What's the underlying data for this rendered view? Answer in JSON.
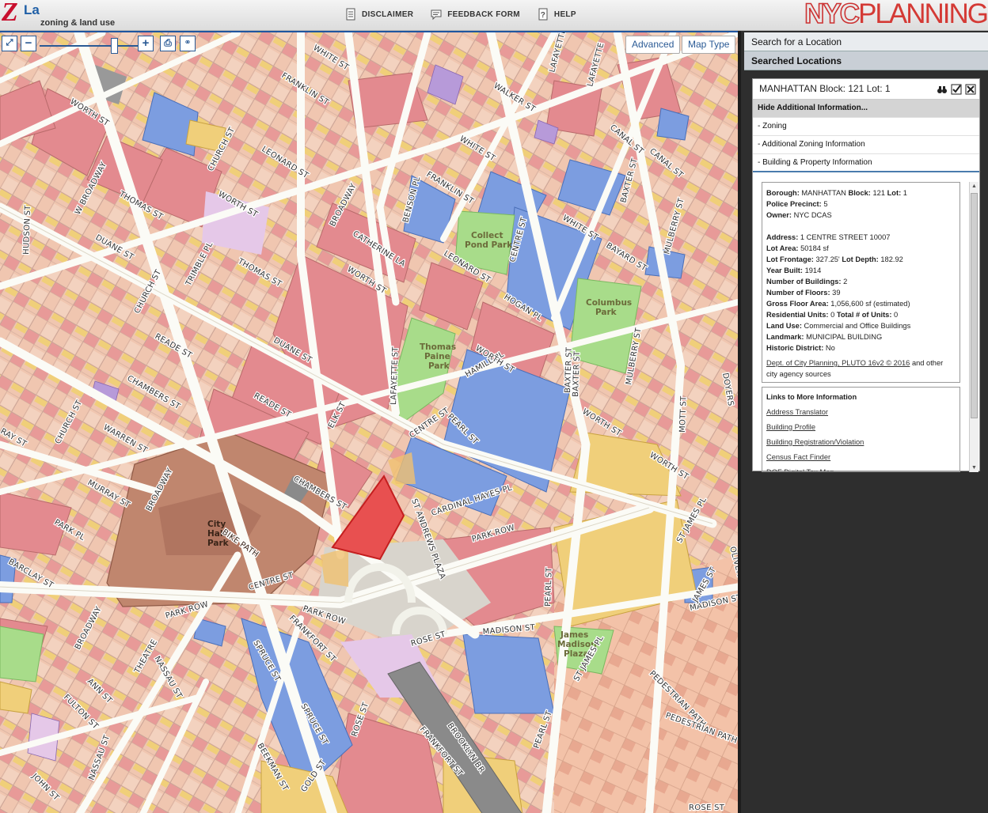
{
  "header": {
    "logo_mark": "Z",
    "logo_la": "La",
    "logo_subtitle": "zoning & land use",
    "nav": [
      {
        "label": "DISCLAIMER",
        "icon": "document-icon"
      },
      {
        "label": "FEEDBACK FORM",
        "icon": "speech-bubble-icon"
      },
      {
        "label": "HELP",
        "icon": "help-icon"
      }
    ],
    "brand_nyc": "NYC",
    "brand_planning": "PLANNING"
  },
  "map": {
    "controls": {
      "zoom_out": "−",
      "zoom_in": "+",
      "advanced_label": "Advanced",
      "map_type_label": "Map Type"
    },
    "parks": [
      "Collect Pond Park",
      "Columbus Park",
      "Thomas Paine Park",
      "City Hall Park",
      "James Madison Plaza"
    ],
    "streets": [
      "WHITE ST",
      "WORTH ST",
      "FRANKLIN ST",
      "LEONARD ST",
      "CHURCH ST",
      "W BROADWAY",
      "THOMAS ST",
      "DUANE ST",
      "HUDSON ST",
      "TRIMBLE PL",
      "READE ST",
      "CHAMBERS ST",
      "WARREN ST",
      "MURRAY ST",
      "PARK PL",
      "BARCLAY ST",
      "BROADWAY",
      "CATHERINE LA",
      "LAFAYETTE ST",
      "CENTRE ST",
      "BAXTER ST",
      "MULBERRY ST",
      "HOGAN PL",
      "PEARL ST",
      "HAMILL PL",
      "CANAL ST",
      "WALKER ST",
      "LAFAYETTE",
      "ELK ST",
      "CARDINAL HAYES PL",
      "ST ANDREWS PLAZA",
      "PARK ROW",
      "MADISON ST",
      "ROSE ST",
      "SPRUCE ST",
      "FRANKFORT ST",
      "BEEKMAN ST",
      "NASSAU ST",
      "ANN ST",
      "FULTON ST",
      "JOHN ST",
      "GOLD ST",
      "BROOKLYN BR",
      "PEDESTRIAN PATH",
      "JAMES ST",
      "ST JAMES PL",
      "OLIVER",
      "MOTT ST",
      "DOYERS",
      "BAYARD ST",
      "BENSON PL",
      "THEATRE",
      "BIKE PATH"
    ]
  },
  "panel": {
    "search_label": "Search for a Location",
    "searched_label": "Searched Locations",
    "card": {
      "title": "MANHATTAN Block: 121 Lot: 1",
      "hide_label": "Hide Additional Information...",
      "sections": [
        "- Zoning",
        "- Additional Zoning Information",
        "- Building & Property Information"
      ],
      "info": {
        "borough_label": "Borough:",
        "borough": "MANHATTAN",
        "block_label": "Block:",
        "block": "121",
        "lot_label": "Lot:",
        "lot": "1",
        "precinct_label": "Police Precinct:",
        "precinct": "5",
        "owner_label": "Owner:",
        "owner": "NYC DCAS",
        "address_label": "Address:",
        "address": "1 CENTRE STREET  10007",
        "lot_area_label": "Lot Area:",
        "lot_area": "50184 sf",
        "frontage_label": "Lot Frontage:",
        "frontage": "327.25'",
        "depth_label": "Lot Depth:",
        "depth": "182.92",
        "year_label": "Year Built:",
        "year": "1914",
        "buildings_label": "Number of Buildings:",
        "buildings": "2",
        "floors_label": "Number of Floors:",
        "floors": "39",
        "gfa_label": "Gross Floor Area:",
        "gfa": "1,056,600 sf (estimated)",
        "resunits_label": "Residential Units:",
        "resunits": "0",
        "totunits_label": "Total # of Units:",
        "totunits": "0",
        "landuse_label": "Land Use:",
        "landuse": "Commercial and Office Buildings",
        "landmark_label": "Landmark:",
        "landmark": "MUNICIPAL BUILDING",
        "historic_label": "Historic District:",
        "historic": "No",
        "source_link": "Dept. of City Planning, PLUTO 16v2 © 2016",
        "source_rest": " and other city agency sources"
      },
      "links_title": "Links to More Information",
      "links": [
        "Address Translator",
        "Building Profile",
        "Building Registration/Violation",
        "Census Fact Finder",
        "DOF Digital Tax Map"
      ]
    }
  },
  "colors": {
    "residential": "#f0c6b0",
    "commercial": "#e38a8f",
    "mixed": "#f0b5a5",
    "public": "#7c9de0",
    "industrial": "#a98fd6",
    "transport": "#f0cf7a",
    "open_space": "#a8dc8a",
    "selected": "#e85050",
    "panel_bg": "#2e2e2e"
  }
}
